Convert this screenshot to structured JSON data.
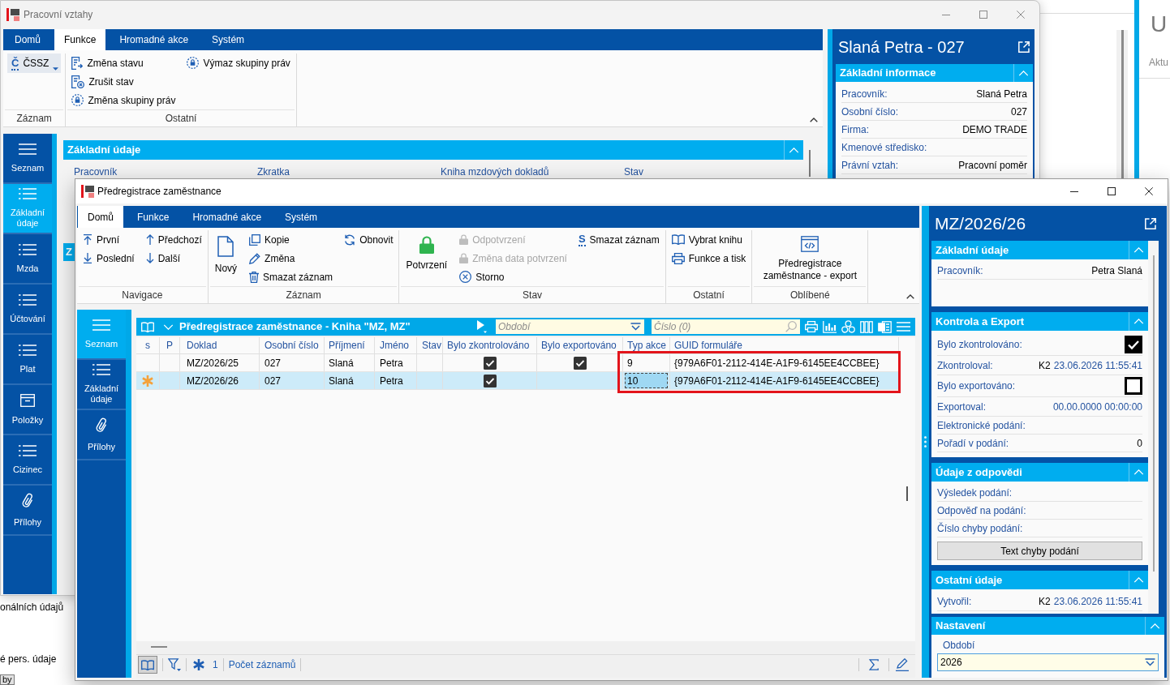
{
  "background": {
    "labels": [
      "onálních údajů",
      "é pers. údaje"
    ],
    "button": "by",
    "side_window": {
      "title": "U",
      "text": "Aktu"
    }
  },
  "back_window": {
    "title": "Pracovní vztahy",
    "tabs": [
      {
        "label": "Domů",
        "selected": false
      },
      {
        "label": "Funkce",
        "selected": true
      },
      {
        "label": "Hromadné akce",
        "selected": false
      },
      {
        "label": "Systém",
        "selected": false
      }
    ],
    "ribbon_groups": [
      {
        "label": "Záznam",
        "columns": [
          [
            {
              "kind": "dropdown",
              "icon_text": "Č",
              "label": "ČSSZ"
            }
          ]
        ]
      },
      {
        "label": "Ostatní",
        "columns": [
          [
            {
              "kind": "small",
              "label": "Změna stavu"
            },
            {
              "kind": "small",
              "label": "Zrušit stav"
            },
            {
              "kind": "small",
              "label": "Změna skupiny práv"
            }
          ],
          [
            {
              "kind": "small",
              "label": "Výmaz skupiny práv"
            }
          ]
        ]
      }
    ],
    "sidebar": [
      {
        "label": "Seznam",
        "selected": false
      },
      {
        "label": "Základní údaje",
        "selected": true
      },
      {
        "label": "Mzda",
        "selected": false
      },
      {
        "label": "Účtování",
        "selected": false
      },
      {
        "label": "Plat",
        "selected": false
      },
      {
        "label": "Položky",
        "selected": false
      },
      {
        "label": "Cizinec",
        "selected": false
      },
      {
        "label": "Přílohy",
        "selected": false
      }
    ],
    "section": {
      "title": "Základní údaje",
      "expanded": true,
      "columns": [
        "Pracovník",
        "Zkratka",
        "Kniha mzdových dokladů",
        "Stav"
      ]
    },
    "peek": [
      {
        "kind": "header",
        "text": "Z"
      }
    ],
    "panel": {
      "title": "Slaná Petra - 027",
      "section": {
        "title": "Základní informace",
        "expanded": true,
        "fields": [
          {
            "kind": "text",
            "label": "Pracovník:",
            "value": "Slaná Petra"
          },
          {
            "kind": "text",
            "label": "Osobní číslo:",
            "value": "027"
          },
          {
            "kind": "text",
            "label": "Firma:",
            "value": "DEMO TRADE"
          },
          {
            "kind": "text",
            "label": "Kmenové středisko:"
          },
          {
            "kind": "text",
            "label": "Právní vztah:",
            "value": "Pracovní poměr"
          }
        ]
      }
    }
  },
  "front_window": {
    "title": "Předregistrace zaměstnance",
    "tabs": [
      {
        "label": "Domů",
        "selected": true
      },
      {
        "label": "Funkce",
        "selected": false
      },
      {
        "label": "Hromadné akce",
        "selected": false
      },
      {
        "label": "Systém",
        "selected": false
      }
    ],
    "ribbon_groups": [
      {
        "label": "Navigace",
        "columns": [
          [
            {
              "kind": "small",
              "label": "První",
              "disabled": false
            },
            {
              "kind": "small",
              "label": "Poslední",
              "disabled": false
            }
          ],
          [
            {
              "kind": "small",
              "label": "Předchozí",
              "disabled": false
            },
            {
              "kind": "small",
              "label": "Další",
              "disabled": false
            }
          ]
        ]
      },
      {
        "label": "Záznam",
        "columns": [
          [
            {
              "kind": "large",
              "label": "Nový",
              "disabled": false
            }
          ],
          [
            {
              "kind": "small",
              "label": "Kopie",
              "disabled": false
            },
            {
              "kind": "small",
              "label": "Změna",
              "disabled": false
            },
            {
              "kind": "small",
              "label": "Smazat záznam",
              "disabled": false
            }
          ],
          [
            {
              "kind": "small",
              "label": "Obnovit",
              "disabled": false
            }
          ]
        ]
      },
      {
        "label": "Stav",
        "columns": [
          [
            {
              "kind": "large",
              "label": "Potvrzení",
              "disabled": false
            }
          ],
          [
            {
              "kind": "small",
              "label": "Odpotvrzení",
              "disabled": true
            },
            {
              "kind": "small",
              "label": "Změna data potvrzení",
              "disabled": true
            },
            {
              "kind": "small",
              "label": "Storno",
              "disabled": false
            }
          ],
          [
            {
              "kind": "small",
              "label": "Smazat záznam",
              "icon_text": "S",
              "disabled": false
            }
          ]
        ]
      },
      {
        "label": "Ostatní",
        "columns": [
          [
            {
              "kind": "small",
              "label": "Vybrat knihu",
              "disabled": false
            },
            {
              "kind": "small",
              "label": "Funkce a tisk",
              "disabled": false
            }
          ]
        ]
      },
      {
        "label": "Oblíbené",
        "columns": [
          [
            {
              "kind": "large",
              "label": "Předregistrace zaměstnance - export",
              "disabled": false
            }
          ]
        ]
      }
    ],
    "sidebar": [
      {
        "label": "Seznam",
        "selected": true
      },
      {
        "label": "Základní údaje",
        "selected": false
      },
      {
        "label": "Přílohy",
        "selected": false
      }
    ],
    "list": {
      "title": "Předregistrace zaměstnance - Kniha \"MZ, MZ\"",
      "period_field": {
        "placeholder": "Období"
      },
      "number_field": {
        "placeholder": "Číslo (0)"
      },
      "columns": [
        "s",
        "P",
        "Doklad",
        "Osobní číslo",
        "Příjmení",
        "Jméno",
        "Stav",
        "Bylo zkontrolováno",
        "Bylo exportováno",
        "Typ akce",
        "GUID formuláře"
      ],
      "rows": [
        {
          "selected": false,
          "flagged": false,
          "document": "MZ/2026/25",
          "personal_number": "027",
          "surname": "Slaná",
          "first_name": "Petra",
          "checked": true,
          "exported": true,
          "action_type": "9",
          "focused": false,
          "form_guid": "{979A6F01-2112-414E-A1F9-6145EE4CCBEE}"
        },
        {
          "selected": true,
          "flagged": true,
          "document": "MZ/2026/26",
          "personal_number": "027",
          "surname": "Slaná",
          "first_name": "Petra",
          "checked": true,
          "exported": false,
          "action_type": "10",
          "focused": true,
          "form_guid": "{979A6F01-2112-414E-A1F9-6145EE4CCBEE}"
        }
      ],
      "highlight": true,
      "footer": {
        "book_button_pressed": true,
        "marked_count": "1",
        "record_count_label": "Počet záznamů"
      }
    },
    "detail": {
      "title": "MZ/2026/26",
      "sections": [
        {
          "title": "Základní údaje",
          "expanded": true,
          "fields": [
            {
              "kind": "text",
              "label": "Pracovník:",
              "value": "Petra Slaná"
            }
          ]
        },
        {
          "title": "Kontrola a Export",
          "expanded": true,
          "fields": [
            {
              "kind": "check",
              "label": "Bylo zkontrolováno:",
              "checked": true
            },
            {
              "kind": "stamp",
              "label": "Zkontroloval:",
              "user": "K2",
              "time": "23.06.2026 11:55:41"
            },
            {
              "kind": "check",
              "label": "Bylo exportováno:",
              "checked": false
            },
            {
              "kind": "stamp",
              "label": "Exportoval:",
              "time": "00.00.0000 00:00:00"
            },
            {
              "kind": "text",
              "label": "Elektronické podání:"
            },
            {
              "kind": "text",
              "label": "Pořadí v podání:",
              "value": "0"
            }
          ]
        },
        {
          "title": "Údaje z odpovědi",
          "expanded": true,
          "fields": [
            {
              "kind": "text",
              "label": "Výsledek podání:"
            },
            {
              "kind": "text",
              "label": "Odpověď na podání:"
            },
            {
              "kind": "text",
              "label": "Číslo chyby podání:"
            },
            {
              "kind": "button",
              "label": "Text chyby podání"
            }
          ]
        },
        {
          "title": "Ostatní údaje",
          "expanded": true,
          "fields": [
            {
              "kind": "stamp",
              "label": "Vytvořil:",
              "user": "K2",
              "time": "23.06.2026 11:55:41"
            }
          ]
        }
      ],
      "settings": {
        "title": "Nastavení",
        "expanded": true,
        "label": "Období",
        "value": "2026"
      }
    }
  }
}
